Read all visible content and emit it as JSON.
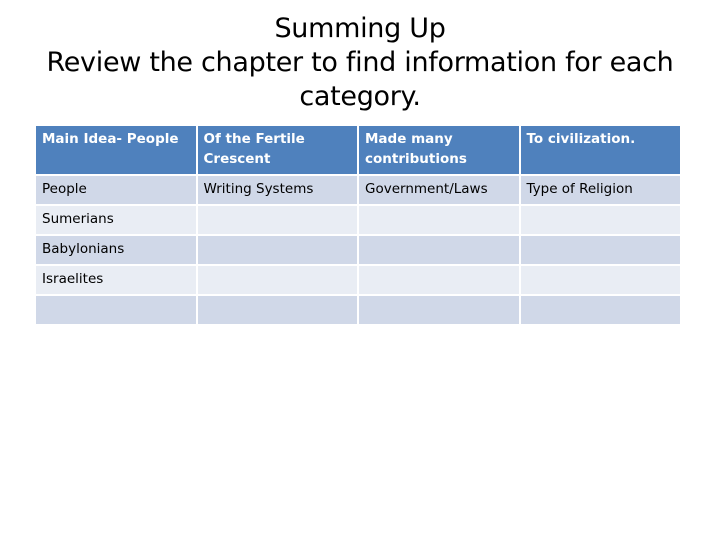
{
  "slide": {
    "title_lines": [
      "Summing Up",
      "Review the chapter to find information for each",
      "category."
    ]
  },
  "table": {
    "header": [
      "Main Idea- People",
      "Of the Fertile Crescent",
      "Made many contributions",
      "To civilization."
    ],
    "rows": [
      [
        "People",
        "Writing Systems",
        "Government/Laws",
        "Type of Religion"
      ],
      [
        "Sumerians",
        "",
        "",
        ""
      ],
      [
        "Babylonians",
        "",
        "",
        ""
      ],
      [
        "Israelites",
        "",
        "",
        ""
      ],
      [
        "",
        "",
        "",
        ""
      ]
    ]
  },
  "colors": {
    "header_bg": "#4f81bd",
    "band_dark": "#d0d8e8",
    "band_light": "#e9edf4"
  }
}
